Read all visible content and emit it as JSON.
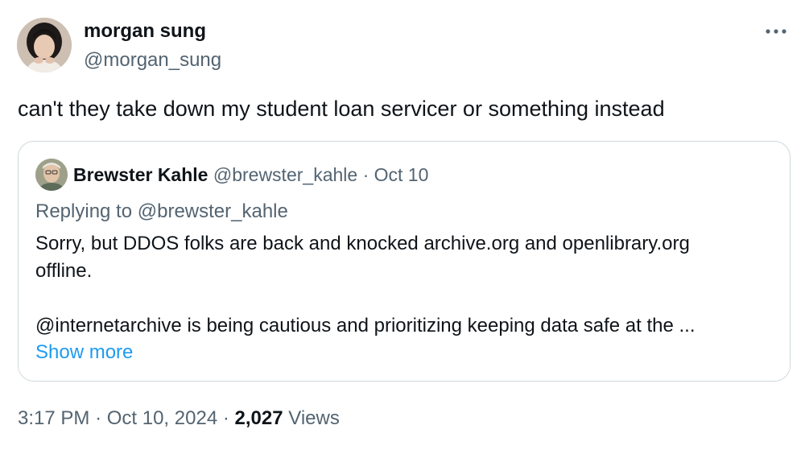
{
  "author": {
    "name": "morgan sung",
    "handle": "@morgan_sung"
  },
  "tweet": {
    "text": "can't they take down my student loan servicer or something instead"
  },
  "quote": {
    "name": "Brewster Kahle",
    "handle": "@brewster_kahle",
    "separator": "·",
    "date": "Oct 10",
    "replying_prefix": "Replying to",
    "replying_to": "@brewster_kahle",
    "body_line1": "Sorry, but DDOS folks are back and knocked archive.org and openlibrary.org",
    "body_line2": "offline.",
    "body_line3": "@internetarchive is being cautious and prioritizing keeping data safe at the ...",
    "show_more": "Show more"
  },
  "meta": {
    "time": "3:17 PM",
    "separator": "·",
    "date": "Oct 10, 2024",
    "views_count": "2,027",
    "views_label": "Views"
  },
  "icons": {
    "more": "more-horizontal-icon"
  },
  "colors": {
    "text_primary": "#0f1419",
    "text_secondary": "#536471",
    "link": "#1d9bf0",
    "border": "#cfd9de"
  }
}
